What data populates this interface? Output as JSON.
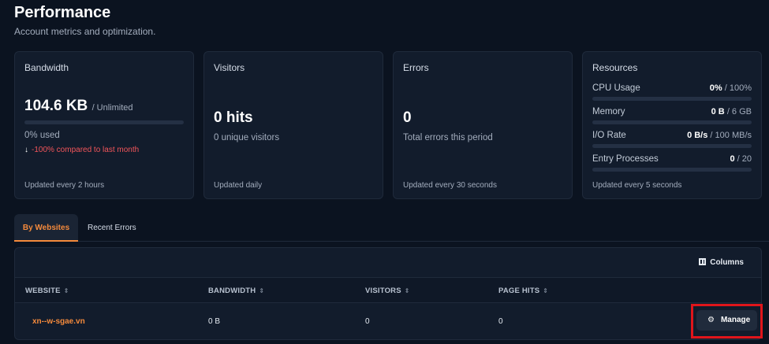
{
  "header": {
    "title": "Performance",
    "subtitle": "Account metrics and optimization."
  },
  "cards": {
    "bandwidth": {
      "title": "Bandwidth",
      "value": "104.6 KB",
      "limit": "/ Unlimited",
      "used": "0% used",
      "used_fraction": 0,
      "trend": "-100% compared to last month",
      "footer": "Updated every 2 hours"
    },
    "visitors": {
      "title": "Visitors",
      "value": "0 hits",
      "sub": "0 unique visitors",
      "footer": "Updated daily"
    },
    "errors": {
      "title": "Errors",
      "value": "0",
      "sub": "Total errors this period",
      "footer": "Updated every 30 seconds"
    },
    "resources": {
      "title": "Resources",
      "rows": [
        {
          "label": "CPU Usage",
          "value": "0%",
          "limit": "/ 100%"
        },
        {
          "label": "Memory",
          "value": "0 B",
          "limit": "/ 6 GB"
        },
        {
          "label": "I/O Rate",
          "value": "0 B/s",
          "limit": "/ 100 MB/s"
        },
        {
          "label": "Entry Processes",
          "value": "0",
          "limit": "/ 20"
        }
      ],
      "footer": "Updated every 5 seconds"
    }
  },
  "tabs": [
    "By Websites",
    "Recent Errors"
  ],
  "table": {
    "columns_button": "Columns",
    "headers": [
      "WEBSITE",
      "BANDWIDTH",
      "VISITORS",
      "PAGE HITS"
    ],
    "rows": [
      {
        "website": "xn--w-sgae.vn",
        "bandwidth": "0 B",
        "visitors": "0",
        "page_hits": "0",
        "action": "Manage"
      }
    ]
  },
  "colors": {
    "accent": "#f48a3c",
    "negative": "#f2555a",
    "highlight": "#e0151b",
    "background": "#0b1320",
    "card": "#121c2c"
  },
  "icons": [
    "down-arrow-icon",
    "sort-icon",
    "columns-icon",
    "gear-icon"
  ]
}
